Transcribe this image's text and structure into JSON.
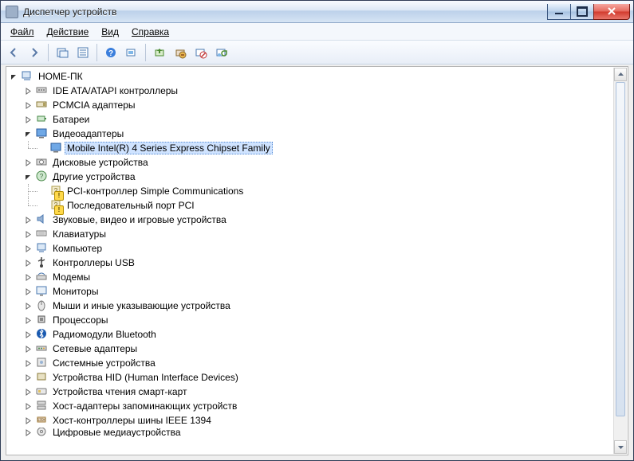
{
  "window": {
    "title": "Диспетчер устройств"
  },
  "menu": {
    "file": "Файл",
    "action": "Действие",
    "view": "Вид",
    "help": "Справка"
  },
  "toolbar": {
    "back": "back",
    "forward": "forward",
    "show_hidden": "show-hidden",
    "properties": "properties",
    "help": "help",
    "refresh": "refresh",
    "update_driver": "update-driver",
    "uninstall": "uninstall",
    "disable": "disable",
    "scan": "scan-hardware",
    "legacy": "add-legacy"
  },
  "tree": {
    "root": "HOME-ПК",
    "items": [
      {
        "label": "IDE ATA/ATAPI контроллеры",
        "icon": "ide"
      },
      {
        "label": "PCMCIA адаптеры",
        "icon": "pcmcia"
      },
      {
        "label": "Батареи",
        "icon": "battery"
      },
      {
        "label": "Видеоадаптеры",
        "icon": "display",
        "expanded": true,
        "children": [
          {
            "label": "Mobile Intel(R) 4 Series Express Chipset Family",
            "icon": "display",
            "selected": true
          }
        ]
      },
      {
        "label": "Дисковые устройства",
        "icon": "disk"
      },
      {
        "label": "Другие устройства",
        "icon": "other",
        "expanded": true,
        "children": [
          {
            "label": "PCI-контроллер Simple Communications",
            "icon": "unknown",
            "warn": true
          },
          {
            "label": "Последовательный порт PCI",
            "icon": "unknown",
            "warn": true
          }
        ]
      },
      {
        "label": "Звуковые, видео и игровые устройства",
        "icon": "sound"
      },
      {
        "label": "Клавиатуры",
        "icon": "keyboard"
      },
      {
        "label": "Компьютер",
        "icon": "computer"
      },
      {
        "label": "Контроллеры USB",
        "icon": "usb"
      },
      {
        "label": "Модемы",
        "icon": "modem"
      },
      {
        "label": "Мониторы",
        "icon": "monitor"
      },
      {
        "label": "Мыши и иные указывающие устройства",
        "icon": "mouse"
      },
      {
        "label": "Процессоры",
        "icon": "cpu"
      },
      {
        "label": "Радиомодули Bluetooth",
        "icon": "bluetooth"
      },
      {
        "label": "Сетевые адаптеры",
        "icon": "network"
      },
      {
        "label": "Системные устройства",
        "icon": "system"
      },
      {
        "label": "Устройства HID (Human Interface Devices)",
        "icon": "hid"
      },
      {
        "label": "Устройства чтения смарт-карт",
        "icon": "smartcard"
      },
      {
        "label": "Хост-адаптеры запоминающих устройств",
        "icon": "storage"
      },
      {
        "label": "Хост-контроллеры шины IEEE 1394",
        "icon": "ieee1394"
      },
      {
        "label": "Цифровые медиаустройства",
        "icon": "media",
        "cut": true
      }
    ]
  }
}
